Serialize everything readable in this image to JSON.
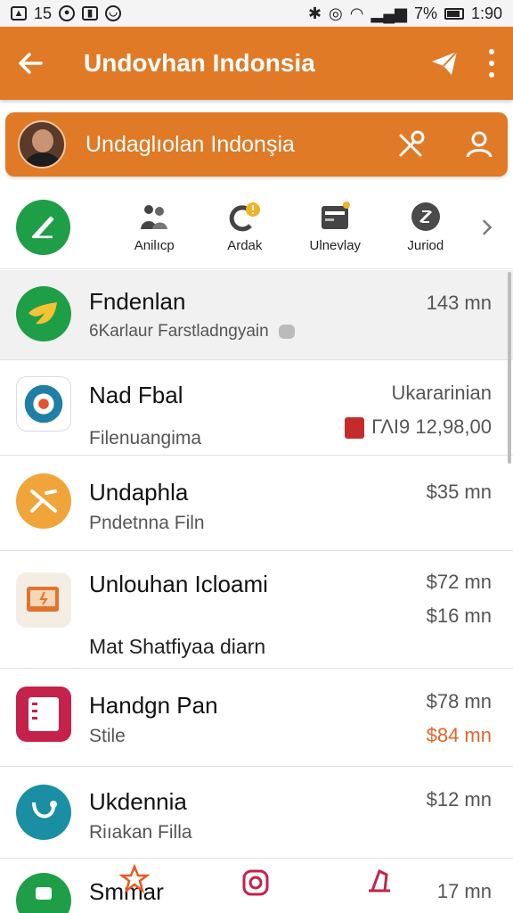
{
  "status_bar": {
    "left_text": "15",
    "battery": "7%",
    "time": "1:90"
  },
  "app_bar": {
    "title": "Undovhan Indonsia"
  },
  "profile": {
    "name": "Undaglıolan Indonşia"
  },
  "quick_actions": [
    {
      "label": "Anilıcp",
      "icon": "people-icon"
    },
    {
      "label": "Ardak",
      "icon": "phone-badge-icon"
    },
    {
      "label": "Ulnevlay",
      "icon": "card-icon"
    },
    {
      "label": "Juriod",
      "icon": "dollar-icon"
    }
  ],
  "list": [
    {
      "title": "Fndenlan",
      "subtitle": "6Karlaur Farstladngyain",
      "meta": "143 mn"
    },
    {
      "title": "Nad Fbal",
      "subtitle": "Filenuangima",
      "meta": "Ukararinian",
      "meta2": "ΓΛΙ9  12,98,00"
    },
    {
      "title": "Undaphla",
      "subtitle": "Pndetnna Filn",
      "meta": "$35 mn"
    },
    {
      "title": "Unlouhan Icloami",
      "subtitle": "Mat Shatfiyaa diarn",
      "meta": "$72 mn",
      "meta2": "$16 mn"
    },
    {
      "title": "Handgn Pan",
      "subtitle": "Stile",
      "meta": "$78 mn",
      "meta2": "$84 mn"
    },
    {
      "title": "Ukdennia",
      "subtitle": "Riıakan Filla",
      "meta": "$12 mn"
    },
    {
      "title": "Smmar",
      "subtitle": "",
      "meta": "17 mn"
    }
  ],
  "colors": {
    "brand": "#e07a26",
    "green": "#1f9e48",
    "orange_text": "#e0662a"
  }
}
